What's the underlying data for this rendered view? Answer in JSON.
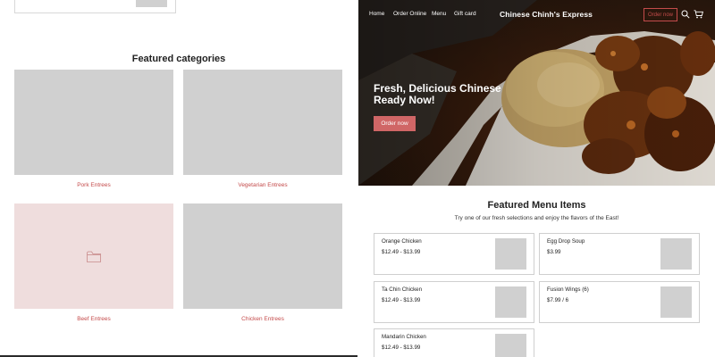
{
  "colors": {
    "accent": "#c44b4b",
    "button_fill": "#d06666",
    "placeholder": "#d0d0d0",
    "placeholder_pink": "#efdddd"
  },
  "categories": {
    "title": "Featured categories",
    "items": [
      {
        "label": "Pork Entrees"
      },
      {
        "label": "Vegetarian Entrees"
      },
      {
        "label": "Beef Entrees",
        "icon": "folder-icon"
      },
      {
        "label": "Chicken Entrees"
      }
    ]
  },
  "nav": {
    "links": [
      "Home",
      "Order Online",
      "Menu",
      "Gift card"
    ],
    "brand": "Chinese Chinh's Express",
    "order_button": "Order now",
    "icons": [
      "search-icon",
      "cart-icon"
    ]
  },
  "hero": {
    "title": "Fresh, Delicious Chinese Ready Now!",
    "button": "Order now"
  },
  "featured_menu": {
    "title": "Featured Menu Items",
    "subtitle": "Try one of our fresh selections and enjoy the flavors of the East!",
    "items": [
      {
        "name": "Orange Chicken",
        "price": "$12.49 - $13.99"
      },
      {
        "name": "Egg Drop Soup",
        "price": "$3.99"
      },
      {
        "name": "Ta Chin Chicken",
        "price": "$12.49 - $13.99"
      },
      {
        "name": "Fusion Wings (6)",
        "price": "$7.99 / 6"
      },
      {
        "name": "Mandarin Chicken",
        "price": "$12.49 - $13.99"
      }
    ]
  }
}
